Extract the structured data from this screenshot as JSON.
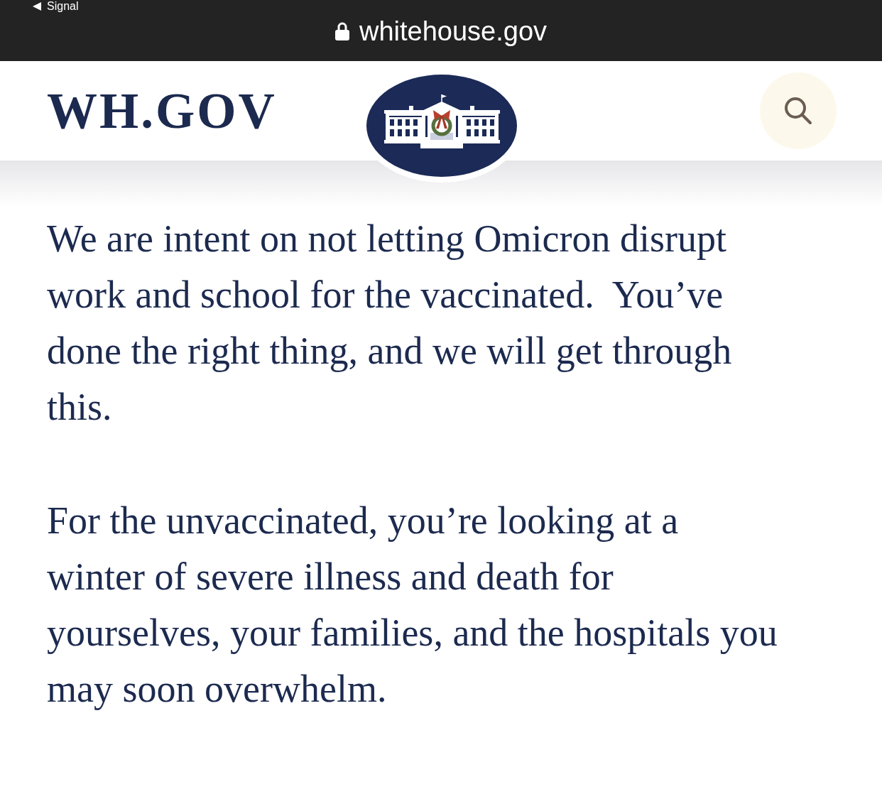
{
  "top_bar": {
    "back_link": "Signal",
    "secure": true,
    "url": "whitehouse.gov"
  },
  "header": {
    "brand": "WH.GOV"
  },
  "article": {
    "paragraphs": [
      {
        "lines": [
          "We are intent on not letting Omicron disrupt",
          "work and school for the vaccinated.  You’ve",
          "done the right thing, and we will get through",
          "this."
        ]
      },
      {
        "lines": [
          "For the unvaccinated, you’re looking at a",
          "winter of severe illness and death for",
          "yourselves, your families, and the hospitals you",
          "may soon overwhelm."
        ]
      }
    ]
  }
}
